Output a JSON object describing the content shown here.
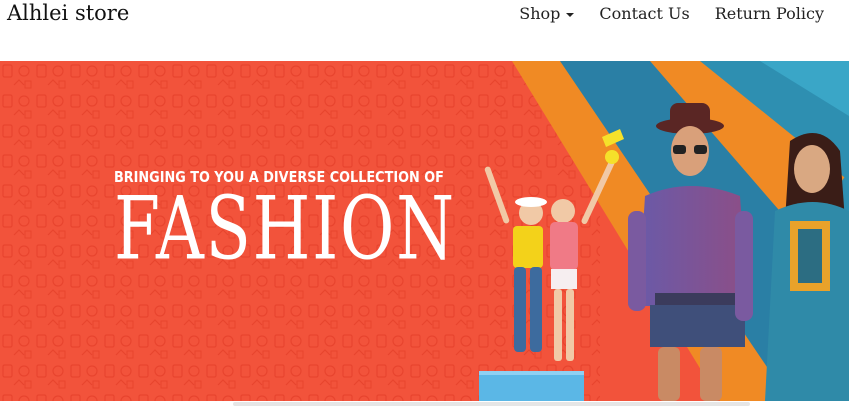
{
  "header": {
    "brand": "Alhlei store",
    "nav": {
      "shop": "Shop",
      "contact": "Contact Us",
      "returns": "Return Policy"
    }
  },
  "banner": {
    "tagline": "BRINGING TO YOU A DIVERSE COLLECTION OF",
    "headline": "FASHION",
    "colors": {
      "primary": "#f2533b",
      "orange": "#f08a24",
      "blue": "#2e8fb1",
      "teal": "#3a9fc2"
    }
  }
}
